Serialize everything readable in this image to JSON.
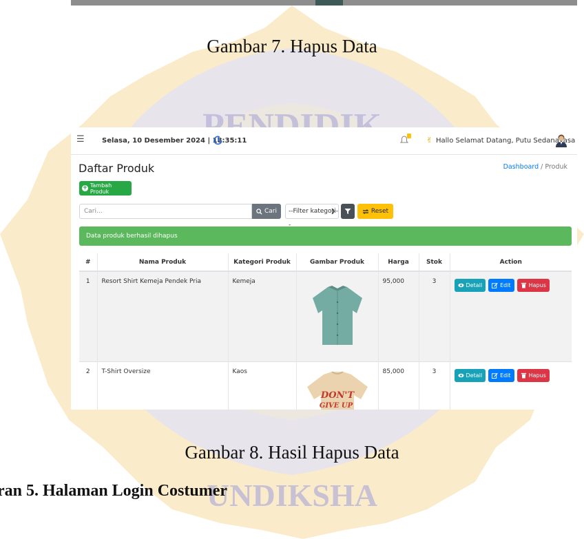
{
  "document": {
    "caption_7": "Gambar  7. Hapus Data",
    "caption_8": "Gambar  8. Hasil Hapus Data",
    "section_heading": "ran 5. Halaman Login Costumer",
    "watermark_text_top": "PENDIDIK",
    "watermark_text_bottom": "UNDIKSHA"
  },
  "topbar": {
    "menu_icon": "hamburger-icon",
    "datetime": "Selasa, 10 Desember 2024 | 18:35:11",
    "theme_icon": "moon-icon",
    "notification_icon": "bell-icon",
    "greeting_icon": "waving-hand-icon",
    "greeting": "Hallo Selamat Datang, Putu Sedanayasa",
    "avatar_icon": "user-avatar-icon"
  },
  "page": {
    "title": "Daftar Produk",
    "breadcrumb": {
      "link": "Dashboard",
      "separator": "/",
      "current": "Produk"
    }
  },
  "toolbar": {
    "add_label": "Tambah Produk",
    "search_placeholder": "Cari...",
    "search_button": "Cari",
    "category_select": "--Filter kategori--",
    "reset_label": "Reset"
  },
  "alert": {
    "message": "Data produk berhasil dihapus",
    "color": "#5cb85c"
  },
  "table": {
    "headers": [
      "#",
      "Nama Produk",
      "Kategori Produk",
      "Gambar Produk",
      "Harga",
      "Stok",
      "Action"
    ],
    "rows": [
      {
        "no": "1",
        "name": "Resort Shirt Kemeja Pendek Pria",
        "category": "Kemeja",
        "image": "teal-short-sleeve-shirt",
        "price": "95,000",
        "stock": "3"
      },
      {
        "no": "2",
        "name": "T-Shirt Oversize",
        "category": "Kaos",
        "image": "beige-oversize-tshirt",
        "price": "85,000",
        "stock": "3",
        "image_text": "DON'T GIVE UP"
      }
    ],
    "actions": {
      "detail": "Detail",
      "edit": "Edit",
      "delete": "Hapus"
    }
  },
  "colors": {
    "success": "#28a745",
    "info": "#17a2b8",
    "primary": "#007bff",
    "danger": "#dc3545",
    "warning": "#ffc107",
    "secondary": "#6c757d",
    "watermark": "#f3c96a"
  }
}
